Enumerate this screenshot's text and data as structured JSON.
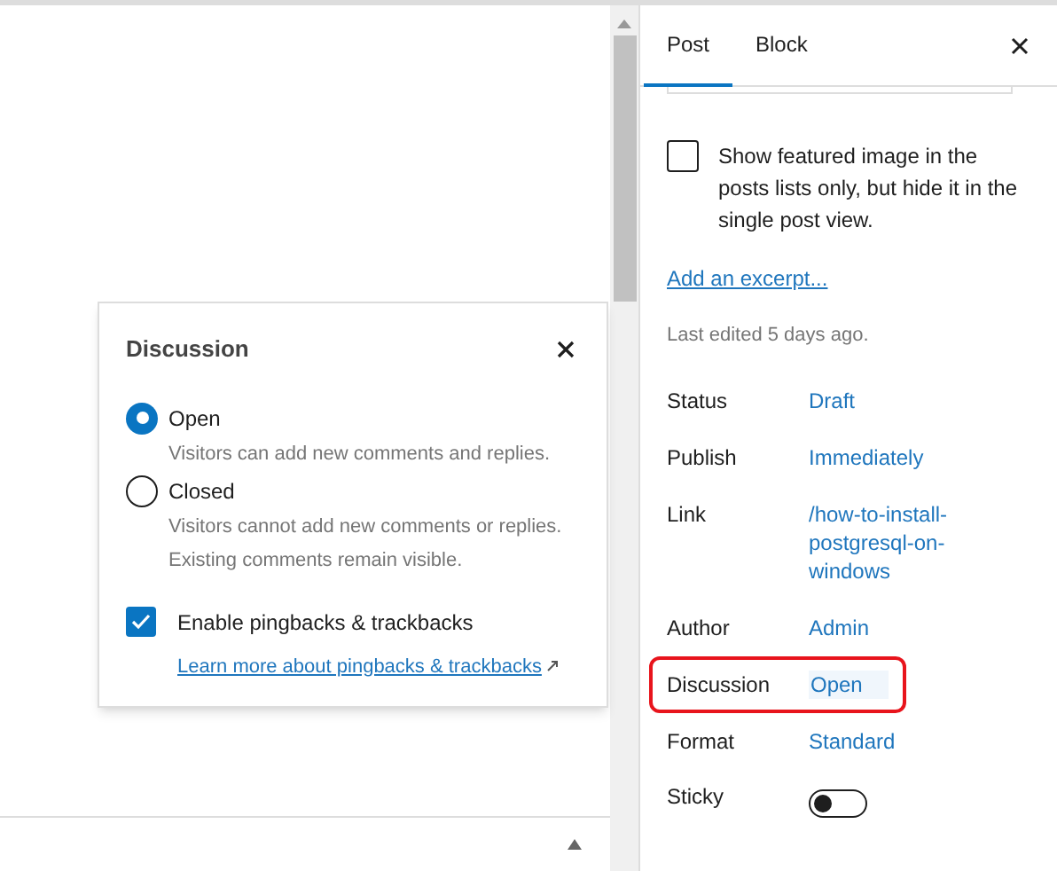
{
  "popover": {
    "title": "Discussion",
    "options": [
      {
        "label": "Open",
        "description": "Visitors can add new comments and replies.",
        "selected": true
      },
      {
        "label": "Closed",
        "description": "Visitors cannot add new comments or replies. Existing comments remain visible.",
        "selected": false
      }
    ],
    "pingbacks": {
      "label": "Enable pingbacks & trackbacks",
      "checked": true
    },
    "learn_more_link": "Learn more about pingbacks & trackbacks"
  },
  "sidebar": {
    "tabs": [
      {
        "label": "Post",
        "selected": true
      },
      {
        "label": "Block",
        "selected": false
      }
    ],
    "featured_image_checkbox": {
      "label": "Show featured image in the posts lists only, but hide it in the single post view.",
      "checked": false
    },
    "excerpt_link": "Add an excerpt...",
    "last_edited": "Last edited 5 days ago.",
    "fields": [
      {
        "label": "Status",
        "value": "Draft",
        "highlighted": false
      },
      {
        "label": "Publish",
        "value": "Immediately",
        "highlighted": false
      },
      {
        "label": "Link",
        "value": "/how-to-install-postgresql-on-windows",
        "highlighted": false
      },
      {
        "label": "Author",
        "value": "Admin",
        "highlighted": false
      },
      {
        "label": "Discussion",
        "value": "Open",
        "highlighted": true
      },
      {
        "label": "Format",
        "value": "Standard",
        "highlighted": false
      }
    ],
    "sticky": {
      "label": "Sticky",
      "on": false
    }
  }
}
